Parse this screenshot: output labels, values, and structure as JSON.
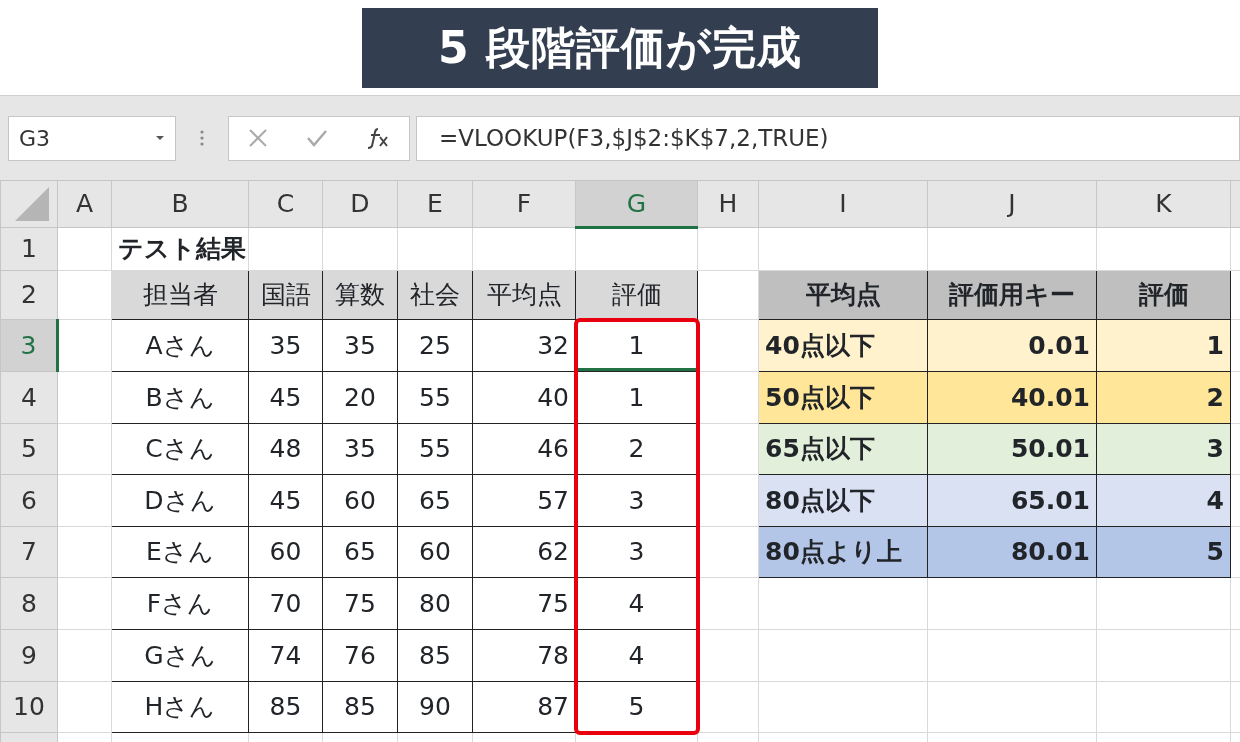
{
  "banner": {
    "title": "5 段階評価が完成"
  },
  "name_box": {
    "value": "G3"
  },
  "formula_bar": {
    "value": "=VLOOKUP(F3,$J$2:$K$7,2,TRUE)"
  },
  "columns": [
    {
      "label": "A",
      "selected": false
    },
    {
      "label": "B",
      "selected": false
    },
    {
      "label": "C",
      "selected": false
    },
    {
      "label": "D",
      "selected": false
    },
    {
      "label": "E",
      "selected": false
    },
    {
      "label": "F",
      "selected": false
    },
    {
      "label": "G",
      "selected": true
    },
    {
      "label": "H",
      "selected": false
    },
    {
      "label": "I",
      "selected": false
    },
    {
      "label": "J",
      "selected": false
    },
    {
      "label": "K",
      "selected": false
    }
  ],
  "rows": [
    {
      "label": "1",
      "selected": false
    },
    {
      "label": "2",
      "selected": false
    },
    {
      "label": "3",
      "selected": true
    },
    {
      "label": "4",
      "selected": false
    },
    {
      "label": "5",
      "selected": false
    },
    {
      "label": "6",
      "selected": false
    },
    {
      "label": "7",
      "selected": false
    },
    {
      "label": "8",
      "selected": false
    },
    {
      "label": "9",
      "selected": false
    },
    {
      "label": "10",
      "selected": false
    }
  ],
  "sheet_title": "テスト結果",
  "score_table": {
    "columns": [
      {
        "label": "担当者",
        "highlighted": false
      },
      {
        "label": "国語",
        "highlighted": false
      },
      {
        "label": "算数",
        "highlighted": false
      },
      {
        "label": "社会",
        "highlighted": false
      },
      {
        "label": "平均点",
        "highlighted": false
      },
      {
        "label": "評価",
        "highlighted": true
      }
    ],
    "rows": [
      [
        "Aさん",
        "35",
        "35",
        "25",
        "32",
        "1"
      ],
      [
        "Bさん",
        "45",
        "20",
        "55",
        "40",
        "1"
      ],
      [
        "Cさん",
        "48",
        "35",
        "55",
        "46",
        "2"
      ],
      [
        "Dさん",
        "45",
        "60",
        "65",
        "57",
        "3"
      ],
      [
        "Eさん",
        "60",
        "65",
        "60",
        "62",
        "3"
      ],
      [
        "Fさん",
        "70",
        "75",
        "80",
        "75",
        "4"
      ],
      [
        "Gさん",
        "74",
        "76",
        "85",
        "78",
        "4"
      ],
      [
        "Hさん",
        "85",
        "85",
        "90",
        "87",
        "5"
      ]
    ]
  },
  "grade_table": {
    "columns": [
      "平均点",
      "評価用キー",
      "評価"
    ],
    "rows": [
      {
        "cells": [
          "40点以下",
          "0.01",
          "1"
        ],
        "color": "#fff2cc"
      },
      {
        "cells": [
          "50点以下",
          "40.01",
          "2"
        ],
        "color": "#ffe699"
      },
      {
        "cells": [
          "65点以下",
          "50.01",
          "3"
        ],
        "color": "#e2efda"
      },
      {
        "cells": [
          "80点以下",
          "65.01",
          "4"
        ],
        "color": "#d9e1f2"
      },
      {
        "cells": [
          "80点より上",
          "80.01",
          "5"
        ],
        "color": "#b4c6e7"
      }
    ]
  }
}
